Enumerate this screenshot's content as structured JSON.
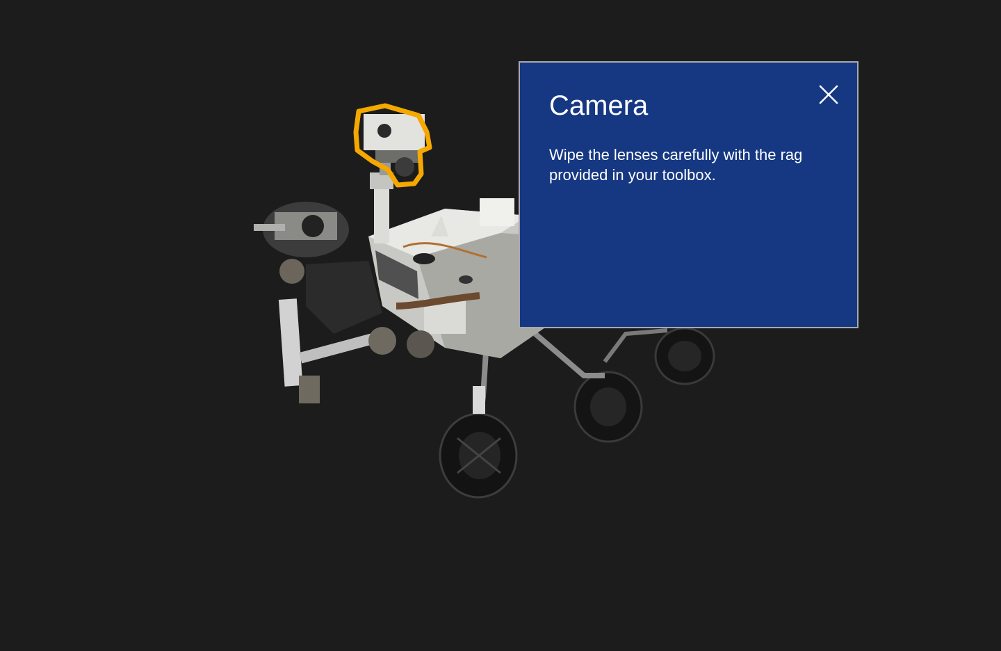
{
  "hotspot": {
    "name": "Camera",
    "highlight_color": "#f5a800"
  },
  "info_panel": {
    "title": "Camera",
    "body": "Wipe the lenses carefully with the rag provided in your toolbox.",
    "close_icon": "close-icon",
    "background_color": "#163882"
  },
  "scene": {
    "model": "mars-rover",
    "background_color": "#1c1c1c"
  }
}
